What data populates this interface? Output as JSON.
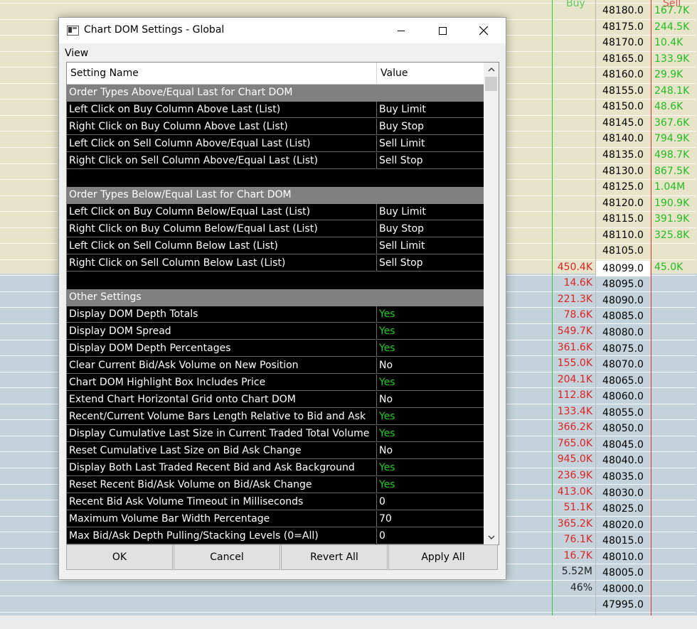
{
  "dom": {
    "buy_header": "Buy",
    "sell_header": "Sell",
    "prices": [
      "48180.0",
      "48175.0",
      "48170.0",
      "48165.0",
      "48160.0",
      "48155.0",
      "48150.0",
      "48145.0",
      "48140.0",
      "48135.0",
      "48130.0",
      "48125.0",
      "48120.0",
      "48115.0",
      "48110.0",
      "48105.0",
      "48099.0",
      "48095.0",
      "48090.0",
      "48085.0",
      "48080.0",
      "48075.0",
      "48070.0",
      "48065.0",
      "48060.0",
      "48055.0",
      "48050.0",
      "48045.0",
      "48040.0",
      "48035.0",
      "48030.0",
      "48025.0",
      "48020.0",
      "48015.0",
      "48010.0",
      "48005.0",
      "48000.0",
      "47995.0"
    ],
    "sell_values": [
      "167.7K",
      "244.5K",
      "10.4K",
      "133.9K",
      "29.9K",
      "248.1K",
      "48.6K",
      "367.6K",
      "794.9K",
      "498.7K",
      "867.5K",
      "1.04M",
      "190.9K",
      "391.9K",
      "325.8K",
      "",
      "45.0K"
    ],
    "buy_values": [
      "450.4K",
      "14.6K",
      "221.3K",
      "78.6K",
      "549.7K",
      "361.6K",
      "155.0K",
      "204.1K",
      "112.8K",
      "133.4K",
      "366.2K",
      "765.0K",
      "945.0K",
      "236.9K",
      "413.0K",
      "51.1K",
      "365.2K",
      "76.1K",
      "16.7K",
      "5.52M",
      "46%"
    ],
    "colors": {
      "buy_text": "#dd2222",
      "sell_text": "#22bb22",
      "totals_text": "#222222"
    }
  },
  "dialog": {
    "title": "Chart DOM Settings - Global",
    "view_label": "View",
    "columns": {
      "name": "Setting Name",
      "value": "Value"
    },
    "rows": [
      {
        "type": "section",
        "label": "Order Types Above/Equal Last for Chart DOM"
      },
      {
        "type": "item",
        "name": "Left Click on Buy Column Above Last (List)",
        "value": "Buy Limit"
      },
      {
        "type": "item",
        "name": "Right Click on Buy Column Above Last (List)",
        "value": "Buy Stop"
      },
      {
        "type": "item",
        "name": "Left Click on Sell Column Above/Equal Last (List)",
        "value": "Sell Limit"
      },
      {
        "type": "item",
        "name": "Right Click on Sell Column Above/Equal Last (List)",
        "value": "Sell Stop"
      },
      {
        "type": "blank"
      },
      {
        "type": "section",
        "label": "Order Types Below/Equal Last for Chart DOM"
      },
      {
        "type": "item",
        "name": "Left Click on Buy Column Below/Equal Last (List)",
        "value": "Buy Limit"
      },
      {
        "type": "item",
        "name": "Right Click on Buy Column Below/Equal Last (List)",
        "value": "Buy Stop"
      },
      {
        "type": "item",
        "name": "Left Click on Sell Column Below Last (List)",
        "value": "Sell Limit"
      },
      {
        "type": "item",
        "name": "Right Click on Sell Column Below Last (List)",
        "value": "Sell Stop"
      },
      {
        "type": "blank"
      },
      {
        "type": "section",
        "label": "Other Settings"
      },
      {
        "type": "item",
        "name": "Display DOM Depth Totals",
        "value": "Yes"
      },
      {
        "type": "item",
        "name": "Display DOM Spread",
        "value": "Yes"
      },
      {
        "type": "item",
        "name": "Display DOM Depth Percentages",
        "value": "Yes"
      },
      {
        "type": "item",
        "name": "Clear Current Bid/Ask Volume on New Position",
        "value": "No"
      },
      {
        "type": "item",
        "name": "Chart DOM Highlight Box Includes Price",
        "value": "Yes"
      },
      {
        "type": "item",
        "name": "Extend Chart Horizontal Grid onto Chart DOM",
        "value": "No"
      },
      {
        "type": "item",
        "name": "Recent/Current Volume Bars Length Relative to Bid and Ask",
        "value": "Yes"
      },
      {
        "type": "item",
        "name": "Display Cumulative Last Size in Current Traded Total Volume",
        "value": "Yes"
      },
      {
        "type": "item",
        "name": "Reset Cumulative Last Size on Bid Ask Change",
        "value": "No"
      },
      {
        "type": "item",
        "name": "Display Both Last Traded Recent Bid and Ask Background",
        "value": "Yes"
      },
      {
        "type": "item",
        "name": "Reset Recent Bid/Ask Volume on Bid/Ask Change",
        "value": "Yes"
      },
      {
        "type": "item",
        "name": "Recent Bid Ask Volume Timeout in Milliseconds",
        "value": "0"
      },
      {
        "type": "item",
        "name": "Maximum Volume Bar Width Percentage",
        "value": "70"
      },
      {
        "type": "item",
        "name": "Max Bid/Ask Depth Pulling/Stacking Levels (0=All)",
        "value": "0"
      }
    ],
    "buttons": {
      "ok": "OK",
      "cancel": "Cancel",
      "revert": "Revert All",
      "apply": "Apply All"
    },
    "icons": {
      "minimize": "minimize-icon",
      "maximize": "maximize-icon",
      "close": "close-icon",
      "scroll_up": "chevron-up-icon",
      "scroll_down": "chevron-down-icon"
    },
    "colors": {
      "yes_value": "#22cc22",
      "section_bg": "#808080",
      "grid_bg": "#000000"
    }
  }
}
